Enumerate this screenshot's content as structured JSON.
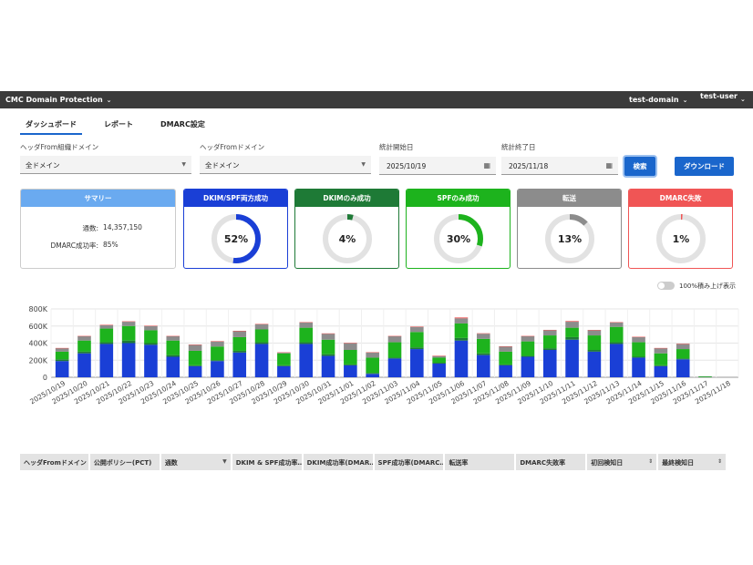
{
  "topbar": {
    "app_title": "CMC Domain Protection",
    "domain": "test-domain",
    "user": "test-user"
  },
  "tabs": [
    {
      "label": "ダッシュボード",
      "active": true
    },
    {
      "label": "レポート",
      "active": false
    },
    {
      "label": "DMARC設定",
      "active": false
    }
  ],
  "filters": {
    "org_domain": {
      "label": "ヘッダFrom組織ドメイン",
      "value": "全ドメイン"
    },
    "from_domain": {
      "label": "ヘッダFromドメイン",
      "value": "全ドメイン"
    },
    "start_date": {
      "label": "統計開始日",
      "value": "2025/10/19"
    },
    "end_date": {
      "label": "統計終了日",
      "value": "2025/11/18"
    },
    "search_label": "検索",
    "download_label": "ダウンロード"
  },
  "summary": {
    "title": "サマリー",
    "count_label": "通数:",
    "count_value": "14,357,150",
    "rate_label": "DMARC成功率:",
    "rate_value": "85%"
  },
  "cards": [
    {
      "title": "DKIM/SPF両方成功",
      "percent_label": "52%",
      "percent": 52,
      "color": "#1a3fd6"
    },
    {
      "title": "DKIMのみ成功",
      "percent_label": "4%",
      "percent": 4,
      "color": "#1e7a36"
    },
    {
      "title": "SPFのみ成功",
      "percent_label": "30%",
      "percent": 30,
      "color": "#1db31d"
    },
    {
      "title": "転送",
      "percent_label": "13%",
      "percent": 13,
      "color": "#8c8c8c"
    },
    {
      "title": "DMARC失敗",
      "percent_label": "1%",
      "percent": 1,
      "color": "#f05555"
    }
  ],
  "toggle_label": "100%積み上げ表示",
  "chart_data": {
    "type": "bar",
    "stacked": true,
    "grid": true,
    "ylim": [
      0,
      800000
    ],
    "yticks": [
      "0",
      "200K",
      "400K",
      "600K",
      "800K"
    ],
    "categories": [
      "2025/10/19",
      "2025/10/20",
      "2025/10/21",
      "2025/10/22",
      "2025/10/23",
      "2025/10/24",
      "2025/10/25",
      "2025/10/26",
      "2025/10/27",
      "2025/10/28",
      "2025/10/29",
      "2025/10/30",
      "2025/10/31",
      "2025/11/01",
      "2025/11/02",
      "2025/11/03",
      "2025/11/04",
      "2025/11/05",
      "2025/11/06",
      "2025/11/07",
      "2025/11/08",
      "2025/11/09",
      "2025/11/10",
      "2025/11/11",
      "2025/11/12",
      "2025/11/13",
      "2025/11/14",
      "2025/11/15",
      "2025/11/16",
      "2025/11/17",
      "2025/11/18"
    ],
    "series": [
      {
        "color": "#1a3fd6",
        "values": [
          190000,
          280000,
          390000,
          400000,
          380000,
          240000,
          130000,
          190000,
          290000,
          390000,
          130000,
          390000,
          250000,
          140000,
          40000,
          220000,
          330000,
          160000,
          430000,
          260000,
          140000,
          240000,
          320000,
          440000,
          300000,
          390000,
          230000,
          130000,
          210000,
          0,
          0
        ]
      },
      {
        "color": "#1e7a36",
        "values": [
          20000,
          20000,
          20000,
          30000,
          20000,
          20000,
          10000,
          10000,
          20000,
          20000,
          10000,
          20000,
          20000,
          10000,
          10000,
          10000,
          20000,
          10000,
          30000,
          20000,
          10000,
          10000,
          20000,
          30000,
          20000,
          20000,
          10000,
          10000,
          10000,
          5000,
          0
        ]
      },
      {
        "color": "#1db31d",
        "values": [
          90000,
          130000,
          160000,
          170000,
          150000,
          170000,
          170000,
          160000,
          160000,
          150000,
          140000,
          170000,
          170000,
          170000,
          180000,
          180000,
          180000,
          60000,
          170000,
          170000,
          150000,
          170000,
          150000,
          110000,
          170000,
          180000,
          170000,
          140000,
          110000,
          5000,
          0
        ]
      },
      {
        "color": "#8c8c8c",
        "values": [
          40000,
          50000,
          40000,
          50000,
          50000,
          50000,
          70000,
          60000,
          70000,
          60000,
          10000,
          60000,
          70000,
          80000,
          60000,
          70000,
          60000,
          20000,
          60000,
          60000,
          60000,
          60000,
          60000,
          70000,
          60000,
          50000,
          60000,
          60000,
          60000,
          0,
          0
        ]
      },
      {
        "color": "#f05555",
        "values": [
          3000,
          4000,
          5000,
          5000,
          4000,
          4000,
          3000,
          3000,
          4000,
          5000,
          2000,
          5000,
          4000,
          3000,
          3000,
          4000,
          4000,
          2000,
          10000,
          5000,
          3000,
          4000,
          5000,
          8000,
          4000,
          5000,
          4000,
          3000,
          3000,
          0,
          0
        ]
      }
    ]
  },
  "table": {
    "headers": [
      {
        "label": "ヘッダFromドメイン",
        "sort": ""
      },
      {
        "label": "公開ポリシー(PCT)",
        "sort": ""
      },
      {
        "label": "通数",
        "sort": "▼"
      },
      {
        "label": "DKIM & SPF成功率…",
        "sort": ""
      },
      {
        "label": "DKIM成功率(DMAR…",
        "sort": ""
      },
      {
        "label": "SPF成功率(DMARC…",
        "sort": ""
      },
      {
        "label": "転送率",
        "sort": ""
      },
      {
        "label": "DMARC失敗率",
        "sort": ""
      },
      {
        "label": "初回検知日",
        "sort": "⇕"
      },
      {
        "label": "最終検知日",
        "sort": "⇕"
      }
    ]
  }
}
